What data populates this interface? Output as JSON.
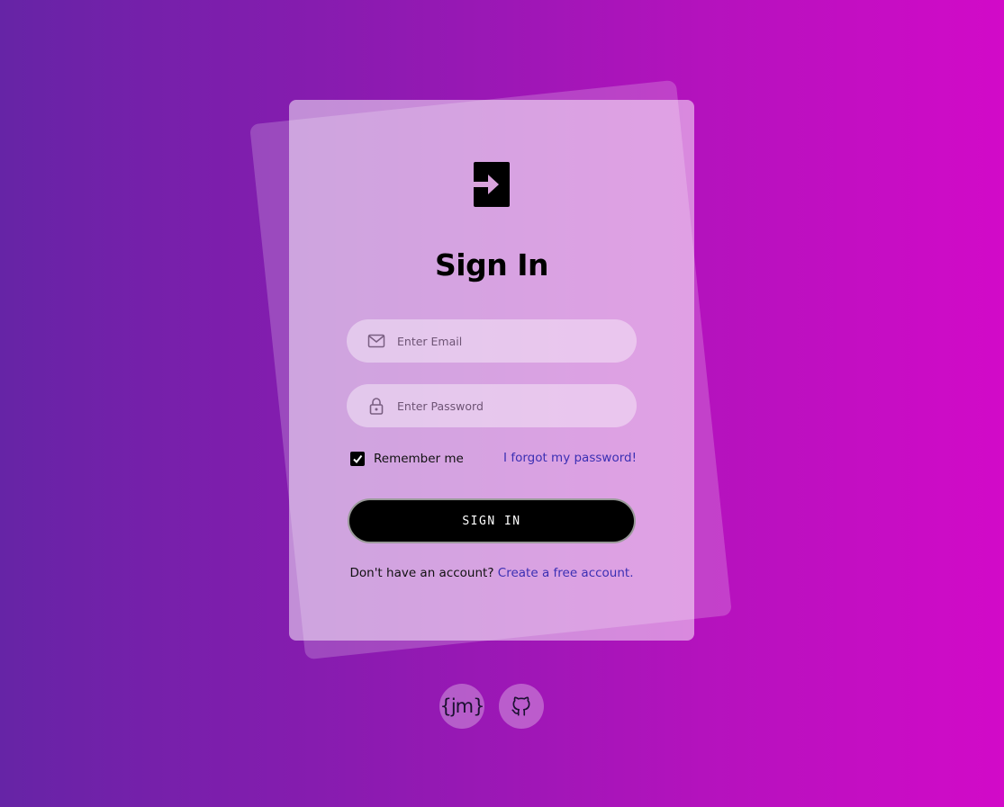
{
  "colors": {
    "accent_link": "#3b2fb3",
    "button_bg": "#000000",
    "gradient_start": "#6624a6",
    "gradient_end": "#d20ac8"
  },
  "login": {
    "logo_icon": "sign-in-arrow-icon",
    "title": "Sign In",
    "email": {
      "icon": "envelope-icon",
      "placeholder": "Enter Email",
      "value": ""
    },
    "password": {
      "icon": "lock-icon",
      "placeholder": "Enter Password",
      "value": ""
    },
    "remember": {
      "label": "Remember me",
      "checked": true
    },
    "forgot_label": "I forgot my password!",
    "submit_label": "SIGN IN",
    "signup_prompt": "Don't have an account?",
    "signup_link": "Create a free account."
  },
  "footer": {
    "links": [
      {
        "icon": "jm-logo-icon",
        "label": "{jm}"
      },
      {
        "icon": "github-icon",
        "label": ""
      }
    ]
  }
}
